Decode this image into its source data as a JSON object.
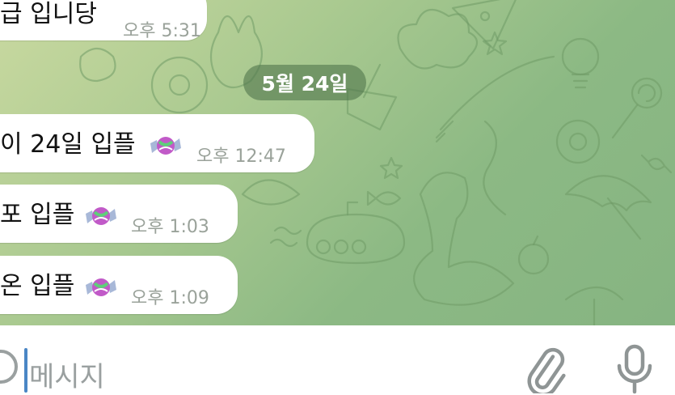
{
  "messages": [
    {
      "text": "급 입니당",
      "time": "오후 5:31",
      "has_candy": false
    },
    {
      "text": "이 24일 입플",
      "time": "오후 12:47",
      "has_candy": true
    },
    {
      "text": "포 입플",
      "time": "오후 1:03",
      "has_candy": true
    },
    {
      "text": "온 입플",
      "time": "오후 1:09",
      "has_candy": true
    }
  ],
  "date_separator": "5월 24일",
  "composer": {
    "placeholder": "메시지",
    "attach_icon": "paperclip-icon",
    "mic_icon": "microphone-icon"
  },
  "colors": {
    "bubble": "#ffffff",
    "date_pill": "#52784e",
    "cursor": "#4a86c5",
    "time_text": "#9aa29a"
  }
}
